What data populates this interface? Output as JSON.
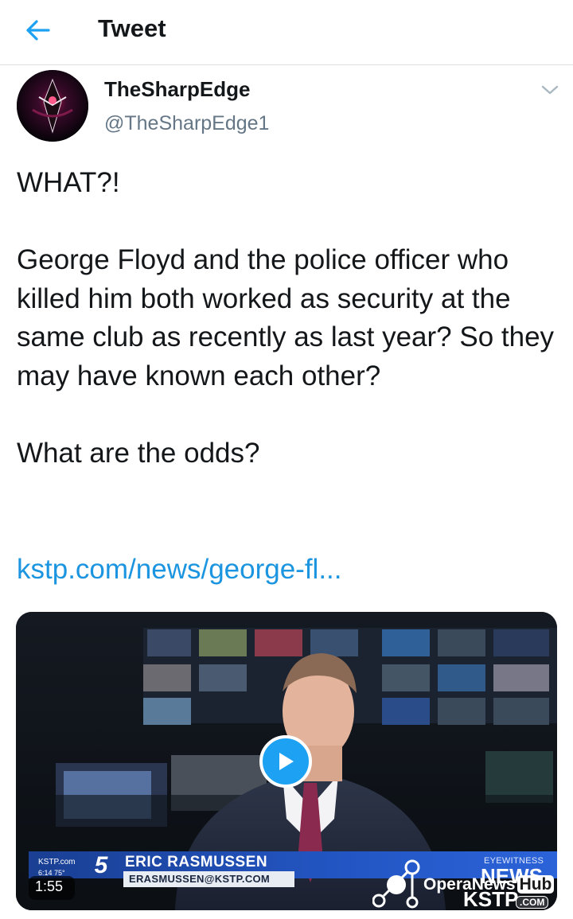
{
  "header": {
    "title": "Tweet",
    "back_icon": "back-arrow-icon",
    "accent": "#1da1f2"
  },
  "author": {
    "name": "TheSharpEdge",
    "handle": "@TheSharpEdge1"
  },
  "tweet": {
    "text": "WHAT?!\n\nGeorge Floyd and the police officer who killed him both worked as security at the same club as recently as last year? So they may have known each other?\n\nWhat are the odds?",
    "link": "kstp.com/news/george-fl..."
  },
  "video": {
    "duration": "1:55",
    "lower_third": {
      "station": "KSTP.com",
      "time_temp": "6:14  75°",
      "channel": "5",
      "name": "ERIC RASMUSSEN",
      "email": "ERASMUSSEN@KSTP.COM",
      "brand_top": "EYEWITNESS",
      "brand_news": "NEWS",
      "brand_kstp": "KSTP",
      "brand_com": ".COM"
    }
  },
  "watermark": {
    "text": "OperaNews",
    "hub": "Hub"
  }
}
